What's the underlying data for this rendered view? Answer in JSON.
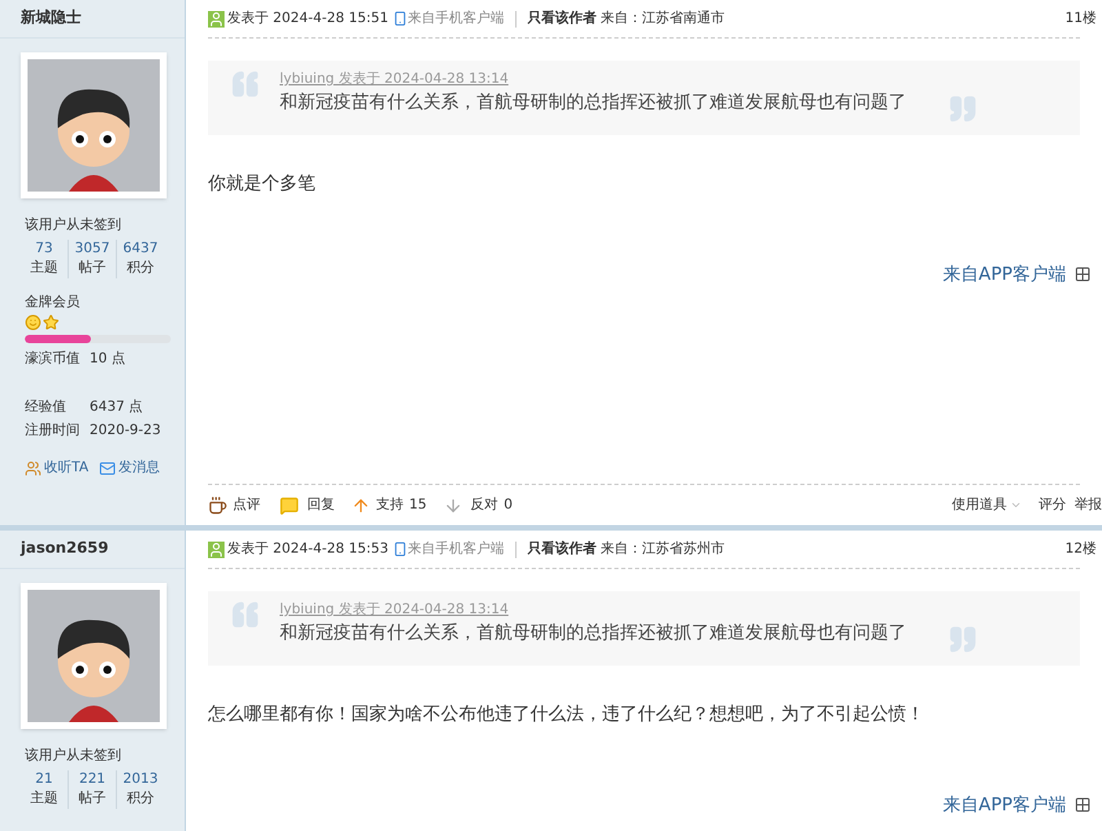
{
  "posts": [
    {
      "author": {
        "name": "新城隐士",
        "checkin": "该用户从未签到",
        "stats": [
          {
            "value": "73",
            "label": "主题"
          },
          {
            "value": "3057",
            "label": "帖子"
          },
          {
            "value": "6437",
            "label": "积分"
          }
        ],
        "group": "金牌会员",
        "level": 0.45,
        "fields": [
          {
            "label": "濠滨币值",
            "value": "10 点"
          },
          {
            "label": "经验值",
            "value": "6437 点"
          },
          {
            "label": "注册时间",
            "value": "2020-9-23"
          }
        ],
        "links": [
          {
            "kind": "follow",
            "label": "收听TA"
          },
          {
            "kind": "message",
            "label": "发消息"
          }
        ]
      },
      "header": {
        "posted": "发表于 2024-4-28 15:51",
        "client": "来自手机客户端",
        "only_author": "只看该作者",
        "location": "来自：江苏省南通市",
        "floor": "11楼"
      },
      "quote": {
        "source": "lybiuing 发表于 2024-04-28 13:14",
        "text": "和新冠疫苗有什么关系，首航母研制的总指挥还被抓了难道发展航母也有问题了"
      },
      "body": "你就是个多笔",
      "app_link": "来自APP客户端",
      "actions": {
        "comment": "点评",
        "reply": "回复",
        "support": "支持",
        "support_count": "15",
        "oppose": "反对",
        "oppose_count": "0",
        "tools": "使用道具",
        "rate": "评分",
        "report": "举报"
      }
    },
    {
      "author": {
        "name": "jason2659",
        "checkin": "该用户从未签到",
        "stats": [
          {
            "value": "21",
            "label": "主题"
          },
          {
            "value": "221",
            "label": "帖子"
          },
          {
            "value": "2013",
            "label": "积分"
          }
        ]
      },
      "header": {
        "posted": "发表于 2024-4-28 15:53",
        "client": "来自手机客户端",
        "only_author": "只看该作者",
        "location": "来自：江苏省苏州市",
        "floor": "12楼"
      },
      "quote": {
        "source": "lybiuing 发表于 2024-04-28 13:14",
        "text": "和新冠疫苗有什么关系，首航母研制的总指挥还被抓了难道发展航母也有问题了"
      },
      "body": "怎么哪里都有你！国家为啥不公布他违了什么法，违了什么纪？想想吧，为了不引起公愤！",
      "app_link": "来自APP客户端"
    }
  ]
}
